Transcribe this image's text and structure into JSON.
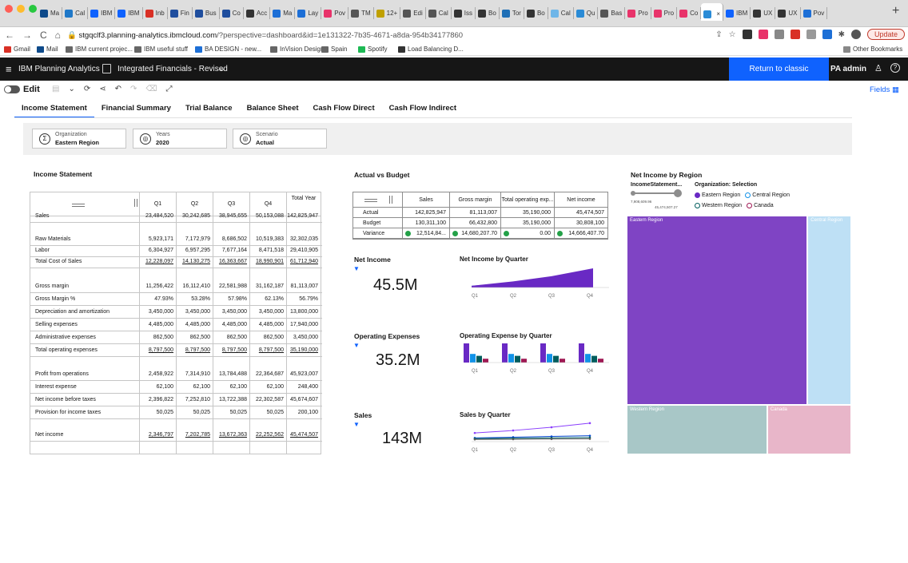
{
  "browser": {
    "tabs": [
      {
        "label": "Ma",
        "color": "#0e4a8a"
      },
      {
        "label": "Cal",
        "color": "#1f78c8"
      },
      {
        "label": "IBM",
        "color": "#0f62fe"
      },
      {
        "label": "IBM",
        "color": "#0f62fe"
      },
      {
        "label": "Inb",
        "color": "#d93025"
      },
      {
        "label": "Fin",
        "color": "#1f4e9e"
      },
      {
        "label": "Bus",
        "color": "#1f4e9e"
      },
      {
        "label": "Co",
        "color": "#1f4e9e"
      },
      {
        "label": "Acc",
        "color": "#333"
      },
      {
        "label": "Ma",
        "color": "#1d6fd6"
      },
      {
        "label": "Lay",
        "color": "#1d6fd6"
      },
      {
        "label": "Pov",
        "color": "#e8336a"
      },
      {
        "label": "TM",
        "color": "#555"
      },
      {
        "label": "12+",
        "color": "#c0a000"
      },
      {
        "label": "Edi",
        "color": "#555"
      },
      {
        "label": "Cal",
        "color": "#555"
      },
      {
        "label": "Iss",
        "color": "#333"
      },
      {
        "label": "Bo",
        "color": "#333"
      },
      {
        "label": "Tor",
        "color": "#1f6fb6"
      },
      {
        "label": "Bo",
        "color": "#333"
      },
      {
        "label": "Cal",
        "color": "#6fb6e8"
      },
      {
        "label": "Qu",
        "color": "#2a8bd6"
      },
      {
        "label": "Bas",
        "color": "#555"
      },
      {
        "label": "Pro",
        "color": "#e8336a"
      },
      {
        "label": "Pro",
        "color": "#e8336a"
      },
      {
        "label": "Co",
        "color": "#e8336a"
      },
      {
        "label": "",
        "color": "#2a8bd6",
        "active": true
      },
      {
        "label": "IBM",
        "color": "#0f62fe"
      },
      {
        "label": "UX",
        "color": "#333"
      },
      {
        "label": "UX",
        "color": "#333"
      },
      {
        "label": "Pov",
        "color": "#1d6fd6"
      }
    ],
    "nav": {
      "back": "←",
      "forward": "→",
      "reload": "C",
      "home": "⌂"
    },
    "url_host": "stgqclf3.planning-analytics.ibmcloud.com",
    "url_rest": "/?perspective=dashboard&id=1e131322-7b35-4671-a8da-954b34177860",
    "update_label": "Update",
    "bookmarks": [
      {
        "label": "Gmail",
        "color": "#d93025"
      },
      {
        "label": "Mail",
        "color": "#0e4a8a"
      },
      {
        "label": "IBM current projec...",
        "color": "#666"
      },
      {
        "label": "IBM useful stuff",
        "color": "#666"
      },
      {
        "label": "BA DESIGN - new...",
        "color": "#1d6fd6"
      },
      {
        "label": "InVision Designs",
        "color": "#666"
      },
      {
        "label": "Spain",
        "color": "#666"
      },
      {
        "label": "Spotify",
        "color": "#1db954"
      },
      {
        "label": "Load Balancing D...",
        "color": "#333"
      }
    ],
    "other_bookmarks": "Other Bookmarks"
  },
  "app": {
    "product": "IBM Planning Analytics",
    "workspace": "Integrated Financials - Revised",
    "return_label": "Return to classic experience",
    "user": "PA admin",
    "edit_label": "Edit",
    "fields_label": "Fields",
    "sheet_tabs": [
      "Income Statement",
      "Financial Summary",
      "Trial Balance",
      "Balance Sheet",
      "Cash Flow Direct",
      "Cash Flow Indirect"
    ]
  },
  "filters": [
    {
      "label": "Organization",
      "value": "Eastern Region",
      "icon": "Σ"
    },
    {
      "label": "Years",
      "value": "2020",
      "icon": "◎"
    },
    {
      "label": "Scenario",
      "value": "Actual",
      "icon": "◎"
    }
  ],
  "income_statement": {
    "title": "Income Statement",
    "columns": [
      "Q1",
      "Q2",
      "Q3",
      "Q4",
      "Total Year"
    ],
    "rows": [
      {
        "label": "Sales",
        "values": [
          "23,484,520",
          "30,242,685",
          "38,945,655",
          "50,153,088",
          "142,825,947"
        ],
        "u": false
      },
      {
        "label": "Raw Materials",
        "values": [
          "5,923,171",
          "7,172,979",
          "8,686,502",
          "10,519,383",
          "32,302,035"
        ],
        "u": false
      },
      {
        "label": "Labor",
        "values": [
          "6,304,927",
          "6,957,295",
          "7,677,164",
          "8,471,518",
          "29,410,905"
        ],
        "u": false
      },
      {
        "label": "Total Cost of Sales",
        "values": [
          "12,228,097",
          "14,130,275",
          "16,363,667",
          "18,990,901",
          "61,712,940"
        ],
        "u": true
      },
      {
        "label": "Gross margin",
        "values": [
          "11,256,422",
          "16,112,410",
          "22,581,988",
          "31,162,187",
          "81,113,007"
        ],
        "u": false
      },
      {
        "label": "Gross Margin %",
        "values": [
          "47.93%",
          "53.28%",
          "57.98%",
          "62.13%",
          "56.79%"
        ],
        "u": false
      },
      {
        "label": "Depreciation and amortization",
        "values": [
          "3,450,000",
          "3,450,000",
          "3,450,000",
          "3,450,000",
          "13,800,000"
        ],
        "u": false
      },
      {
        "label": "Selling expenses",
        "values": [
          "4,485,000",
          "4,485,000",
          "4,485,000",
          "4,485,000",
          "17,940,000"
        ],
        "u": false
      },
      {
        "label": "Administrative expenses",
        "values": [
          "862,500",
          "862,500",
          "862,500",
          "862,500",
          "3,450,000"
        ],
        "u": false
      },
      {
        "label": "Total operating expenses",
        "values": [
          "8,797,500",
          "8,797,500",
          "8,797,500",
          "8,797,500",
          "35,190,000"
        ],
        "u": true
      },
      {
        "label": "Profit from operations",
        "values": [
          "2,458,922",
          "7,314,910",
          "13,784,488",
          "22,364,687",
          "45,923,007"
        ],
        "u": false
      },
      {
        "label": "Interest expense",
        "values": [
          "62,100",
          "62,100",
          "62,100",
          "62,100",
          "248,400"
        ],
        "u": false
      },
      {
        "label": "Net income before taxes",
        "values": [
          "2,396,822",
          "7,252,810",
          "13,722,388",
          "22,302,587",
          "45,674,607"
        ],
        "u": false
      },
      {
        "label": "Provision for income taxes",
        "values": [
          "50,025",
          "50,025",
          "50,025",
          "50,025",
          "200,100"
        ],
        "u": false
      },
      {
        "label": "Net income",
        "values": [
          "2,346,797",
          "7,202,785",
          "13,672,363",
          "22,252,562",
          "45,474,507"
        ],
        "u": true
      }
    ]
  },
  "actual_vs_budget": {
    "title": "Actual vs Budget",
    "columns": [
      "Sales",
      "Gross margin",
      "Total operating exp...",
      "Net income"
    ],
    "rows": [
      {
        "label": "Actual",
        "values": [
          "142,825,947",
          "81,113,007",
          "35,190,000",
          "45,474,507"
        ]
      },
      {
        "label": "Budget",
        "values": [
          "130,311,100",
          "66,432,800",
          "35,190,000",
          "30,808,100"
        ]
      },
      {
        "label": "Variance",
        "values": [
          "12,514,84...",
          "14,680,207.70",
          "0.00",
          "14,666,407.70"
        ]
      }
    ],
    "variance_color": "#24a148"
  },
  "kpis": [
    {
      "title": "Net Income",
      "value": "45.5M",
      "chart_title": "Net Income by Quarter"
    },
    {
      "title": "Operating Expenses",
      "value": "35.2M",
      "chart_title": "Operating Expense by Quarter"
    },
    {
      "title": "Sales",
      "value": "143M",
      "chart_title": "Sales by Quarter"
    }
  ],
  "filter_icon": "▼",
  "chart_data": [
    {
      "type": "area",
      "title": "Net Income by Quarter",
      "categories": [
        "Q1",
        "Q2",
        "Q3",
        "Q4"
      ],
      "series": [
        {
          "values": [
            2,
            7,
            13,
            22
          ]
        },
        {
          "values": [
            2,
            6,
            12,
            20
          ]
        },
        {
          "values": [
            1,
            4,
            8,
            14
          ]
        },
        {
          "values": [
            1,
            3,
            6,
            10
          ]
        }
      ],
      "colors": [
        "#6929c4",
        "#1192e8",
        "#005d5d",
        "#9f1853"
      ]
    },
    {
      "type": "bar",
      "title": "Operating Expense by Quarter",
      "categories": [
        "Q1",
        "Q2",
        "Q3",
        "Q4"
      ],
      "series": [
        {
          "values": [
            10,
            10,
            10,
            10
          ]
        },
        {
          "values": [
            4.5,
            4.5,
            4.5,
            4.5
          ]
        },
        {
          "values": [
            3.5,
            3.5,
            3.5,
            3.5
          ]
        },
        {
          "values": [
            2,
            2,
            2,
            2
          ]
        }
      ],
      "colors": [
        "#6929c4",
        "#1192e8",
        "#005d5d",
        "#9f1853"
      ]
    },
    {
      "type": "line",
      "title": "Sales by Quarter",
      "categories": [
        "Q1",
        "Q2",
        "Q3",
        "Q4"
      ],
      "series": [
        {
          "values": [
            23.5,
            30.2,
            38.9,
            50.2
          ]
        },
        {
          "values": [
            10,
            12,
            14,
            16
          ]
        },
        {
          "values": [
            8,
            9,
            10,
            11
          ]
        },
        {
          "values": [
            6,
            6.5,
            7,
            7.5
          ]
        }
      ],
      "colors": [
        "#8a3ffc",
        "#0043ce",
        "#005d5d",
        "#5a5a5a"
      ]
    },
    {
      "type": "treemap",
      "title": "Net Income by Region",
      "series": [
        {
          "name": "Eastern Region",
          "value": 45.5
        },
        {
          "name": "Central Region",
          "value": 11
        },
        {
          "name": "Western Region",
          "value": 9.2
        },
        {
          "name": "Canada",
          "value": 5.5
        }
      ],
      "colors": [
        "#7f44c4",
        "#bee0f5",
        "#a8c7c7",
        "#e8b6c9"
      ]
    }
  ],
  "region": {
    "title": "Net Income by Region",
    "measure_label": "IncomeStatement...",
    "org_label": "Organization: Selection",
    "slider_min": "7,908,609.96",
    "slider_max": "45,474,507.27",
    "legend": [
      {
        "label": "Eastern Region",
        "color": "#6929c4",
        "filled": true
      },
      {
        "label": "Central Region",
        "color": "#1192e8",
        "filled": false
      },
      {
        "label": "Western Region",
        "color": "#005d5d",
        "filled": false
      },
      {
        "label": "Canada",
        "color": "#9f1853",
        "filled": false
      }
    ]
  }
}
